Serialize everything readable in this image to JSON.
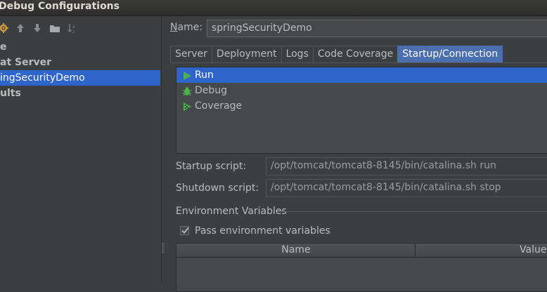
{
  "window": {
    "title": "Debug Configurations"
  },
  "toolbar": {
    "icons": [
      "settings-wrench-icon",
      "move-up-icon",
      "move-down-icon",
      "folder-icon",
      "sort-icon"
    ]
  },
  "tree": {
    "items": [
      {
        "label": "e",
        "bold": true
      },
      {
        "label": "at Server",
        "bold": true
      },
      {
        "label": "ingSecurityDemo",
        "bold": false,
        "selected": true
      },
      {
        "label": "ults",
        "bold": true
      }
    ]
  },
  "config": {
    "name_label_prefix": "N",
    "name_label_rest": "ame:",
    "name_value": "springSecurityDemo"
  },
  "tabs": [
    {
      "label": "Server"
    },
    {
      "label": "Deployment"
    },
    {
      "label": "Logs"
    },
    {
      "label": "Code Coverage"
    },
    {
      "label": "Startup/Connection",
      "active": true
    }
  ],
  "modes": [
    {
      "label": "Run",
      "icon": "run-icon",
      "selected": true
    },
    {
      "label": "Debug",
      "icon": "debug-bug-icon"
    },
    {
      "label": "Coverage",
      "icon": "coverage-icon"
    }
  ],
  "startup": {
    "label": "Startup script:",
    "value": "/opt/tomcat/tomcat8-8145/bin/catalina.sh run"
  },
  "shutdown": {
    "label": "Shutdown script:",
    "value": "/opt/tomcat/tomcat8-8145/bin/catalina.sh stop"
  },
  "env": {
    "section_title": "Environment Variables",
    "pass_label": "Pass environment variables",
    "pass_checked": true,
    "columns": {
      "name": "Name",
      "value": "Value"
    }
  },
  "colors": {
    "accent": "#2f65ca",
    "tab_active": "#4b6eaf",
    "run_green": "#49b34a"
  }
}
